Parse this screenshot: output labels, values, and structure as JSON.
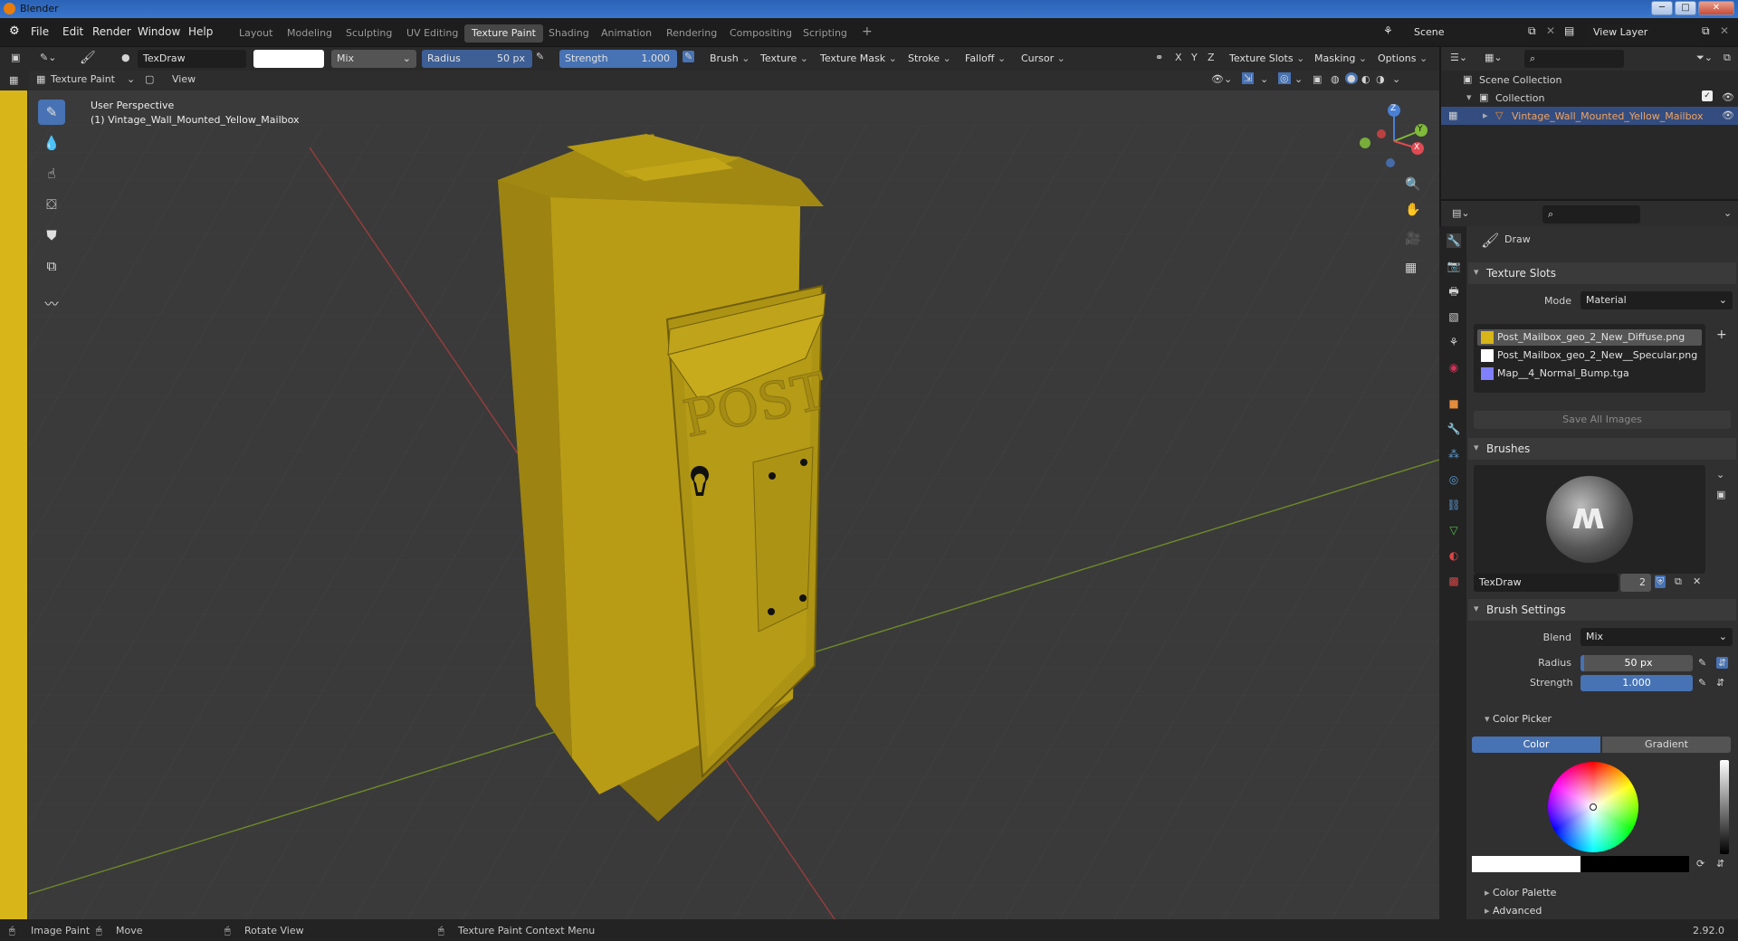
{
  "app": {
    "title": "Blender",
    "version": "2.92.0"
  },
  "menu": [
    "File",
    "Edit",
    "Render",
    "Window",
    "Help"
  ],
  "workspaces": [
    "Layout",
    "Modeling",
    "Sculpting",
    "UV Editing",
    "Texture Paint",
    "Shading",
    "Animation",
    "Rendering",
    "Compositing",
    "Scripting"
  ],
  "active_workspace": "Texture Paint",
  "scene": {
    "name": "Scene",
    "view_layer": "View Layer"
  },
  "toolheader": {
    "brush_name": "TexDraw",
    "blend": "Mix",
    "radius_label": "Radius",
    "radius_value": "50 px",
    "strength_label": "Strength",
    "strength_value": "1.000",
    "menus": [
      "Brush",
      "Texture",
      "Texture Mask",
      "Stroke",
      "Falloff",
      "Cursor"
    ],
    "axes": [
      "X",
      "Y",
      "Z"
    ],
    "right_menus": [
      "Texture Slots",
      "Masking",
      "Options"
    ]
  },
  "viewheader": {
    "mode": "Texture Paint",
    "view": "View"
  },
  "viewport": {
    "perspective": "User Perspective",
    "object": "(1) Vintage_Wall_Mounted_Yellow_Mailbox",
    "embossed_text": "POST",
    "gizmo": {
      "x": "X",
      "y": "Y",
      "z": "Z"
    }
  },
  "outliner": {
    "root": "Scene Collection",
    "collection": "Collection",
    "object": "Vintage_Wall_Mounted_Yellow_Mailbox"
  },
  "properties": {
    "tool": "Draw",
    "texture_slots": {
      "title": "Texture Slots",
      "mode_label": "Mode",
      "mode": "Material",
      "items": [
        {
          "name": "Post_Mailbox_geo_2_New_Diffuse.png",
          "color": "#d8b61a"
        },
        {
          "name": "Post_Mailbox_geo_2_New__Specular.png",
          "color": "#ffffff"
        },
        {
          "name": "Map__4_Normal_Bump.tga",
          "color": "#8080ff"
        }
      ],
      "save_all": "Save All Images"
    },
    "brushes": {
      "title": "Brushes",
      "name": "TexDraw",
      "users": "2"
    },
    "brush_settings": {
      "title": "Brush Settings",
      "blend_label": "Blend",
      "blend": "Mix",
      "radius_label": "Radius",
      "radius": "50 px",
      "strength_label": "Strength",
      "strength": "1.000"
    },
    "color_picker": {
      "title": "Color Picker",
      "tab_color": "Color",
      "tab_gradient": "Gradient"
    },
    "color_palette": "Color Palette",
    "advanced": "Advanced"
  },
  "statusbar": {
    "left": "Image Paint",
    "move": "Move",
    "rotate": "Rotate View",
    "context": "Texture Paint Context Menu",
    "version": "2.92.0"
  },
  "colors": {
    "accent": "#4772b3",
    "mailbox": "#bfa31a",
    "background": "#303030"
  }
}
